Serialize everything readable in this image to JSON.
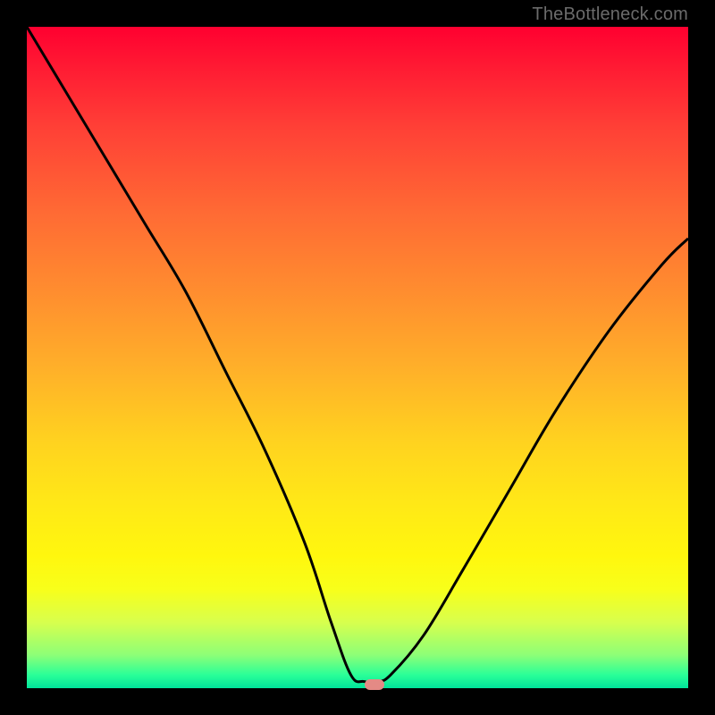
{
  "attribution": "TheBottleneck.com",
  "colors": {
    "top": "#ff0030",
    "bottom": "#00e49a",
    "curve": "#000000",
    "marker": "#e48a85",
    "frame": "#000000"
  },
  "chart_data": {
    "type": "line",
    "title": "",
    "xlabel": "",
    "ylabel": "",
    "xlim": [
      0,
      100
    ],
    "ylim": [
      0,
      100
    ],
    "grid": false,
    "legend": false,
    "series": [
      {
        "name": "bottleneck-curve",
        "x": [
          0,
          6,
          12,
          18,
          24,
          30,
          36,
          42,
          46,
          49,
          51,
          53,
          55,
          60,
          66,
          73,
          80,
          88,
          96,
          100
        ],
        "y": [
          100,
          90,
          80,
          70,
          60,
          48,
          36,
          22,
          10,
          2,
          1,
          1,
          2,
          8,
          18,
          30,
          42,
          54,
          64,
          68
        ]
      }
    ],
    "annotations": [
      {
        "name": "minimum-marker",
        "x": 52.5,
        "y": 0.5
      }
    ],
    "gradient_stops": [
      {
        "pos": 0,
        "color": "#ff0030"
      },
      {
        "pos": 50,
        "color": "#ffb129"
      },
      {
        "pos": 80,
        "color": "#fff70e"
      },
      {
        "pos": 100,
        "color": "#00e49a"
      }
    ]
  }
}
